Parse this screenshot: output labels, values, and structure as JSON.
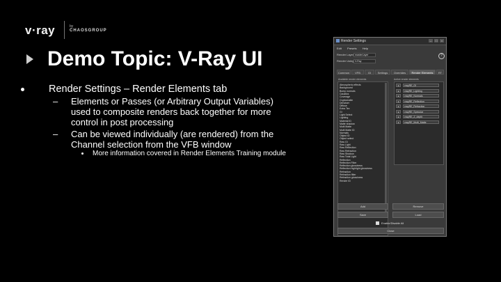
{
  "logo": {
    "brand": "v·ray",
    "by": "by",
    "company": "CHAOSGROUP"
  },
  "slide": {
    "title": "Demo Topic: V-Ray UI",
    "bullet1": "Render Settings – Render Elements tab",
    "sub1_dash": "–",
    "sub1": "Elements or Passes (or Arbitrary Output Variables) used to composite renders back together for more control in post processing",
    "sub2_dash": "–",
    "sub2": "Can be viewed individually (are rendered) from the Channel selection from the VFB window",
    "subsub": "More information covered in Render Elements Training module"
  },
  "window": {
    "title": "Render Settings",
    "controls": [
      "–",
      "□",
      "×"
    ],
    "menu": [
      "Edit",
      "Presets",
      "Help"
    ],
    "render_layer_label": "Render Layer",
    "render_layer_value": "masterLayer",
    "render_using_label": "Render Using",
    "render_using_value": "V-Ray",
    "help_icon": "?",
    "tabs": [
      "Common",
      "VFB",
      "GI",
      "Settings",
      "Overrides",
      "Render Elements",
      "RT"
    ],
    "active_tab_index": 5,
    "available_label": "Available render elements",
    "active_label": "Active render elements",
    "available_elements": [
      "Atmospheric effects",
      "Background",
      "Bump normals",
      "Caustics",
      "Coverage",
      "Cryptomatte",
      "Denoiser",
      "Diffuse",
      "Extra Tex",
      "GI",
      "Light Select",
      "Lighting",
      "Material ID",
      "Matte shadow",
      "Multi Matte",
      "Multi Matte ID",
      "Normals",
      "Object ID",
      "Object select",
      "Raw GI",
      "Raw Light",
      "Raw Reflection",
      "Raw Refraction",
      "Raw Shadow",
      "Raw Total Light",
      "Reflection",
      "Reflection Filter",
      "Reflection glossiness",
      "Reflection highlight glossiness",
      "Refraction",
      "Refraction filter",
      "Refraction glossiness",
      "Render ID"
    ],
    "active_elements": [
      "vrayRE_GI",
      "vrayRE_Lighting",
      "vrayRE_Normals",
      "vrayRE_Reflection",
      "vrayRE_Refraction",
      "vrayRE_Specular",
      "vrayRE_Z_depth",
      "vrayRE_Multi_Matte"
    ],
    "buttons": {
      "add": "Add",
      "remove": "Remove",
      "save": "Save",
      "load": "Load",
      "close": "Close"
    },
    "enable_all_label": "Enable/Disable All"
  }
}
